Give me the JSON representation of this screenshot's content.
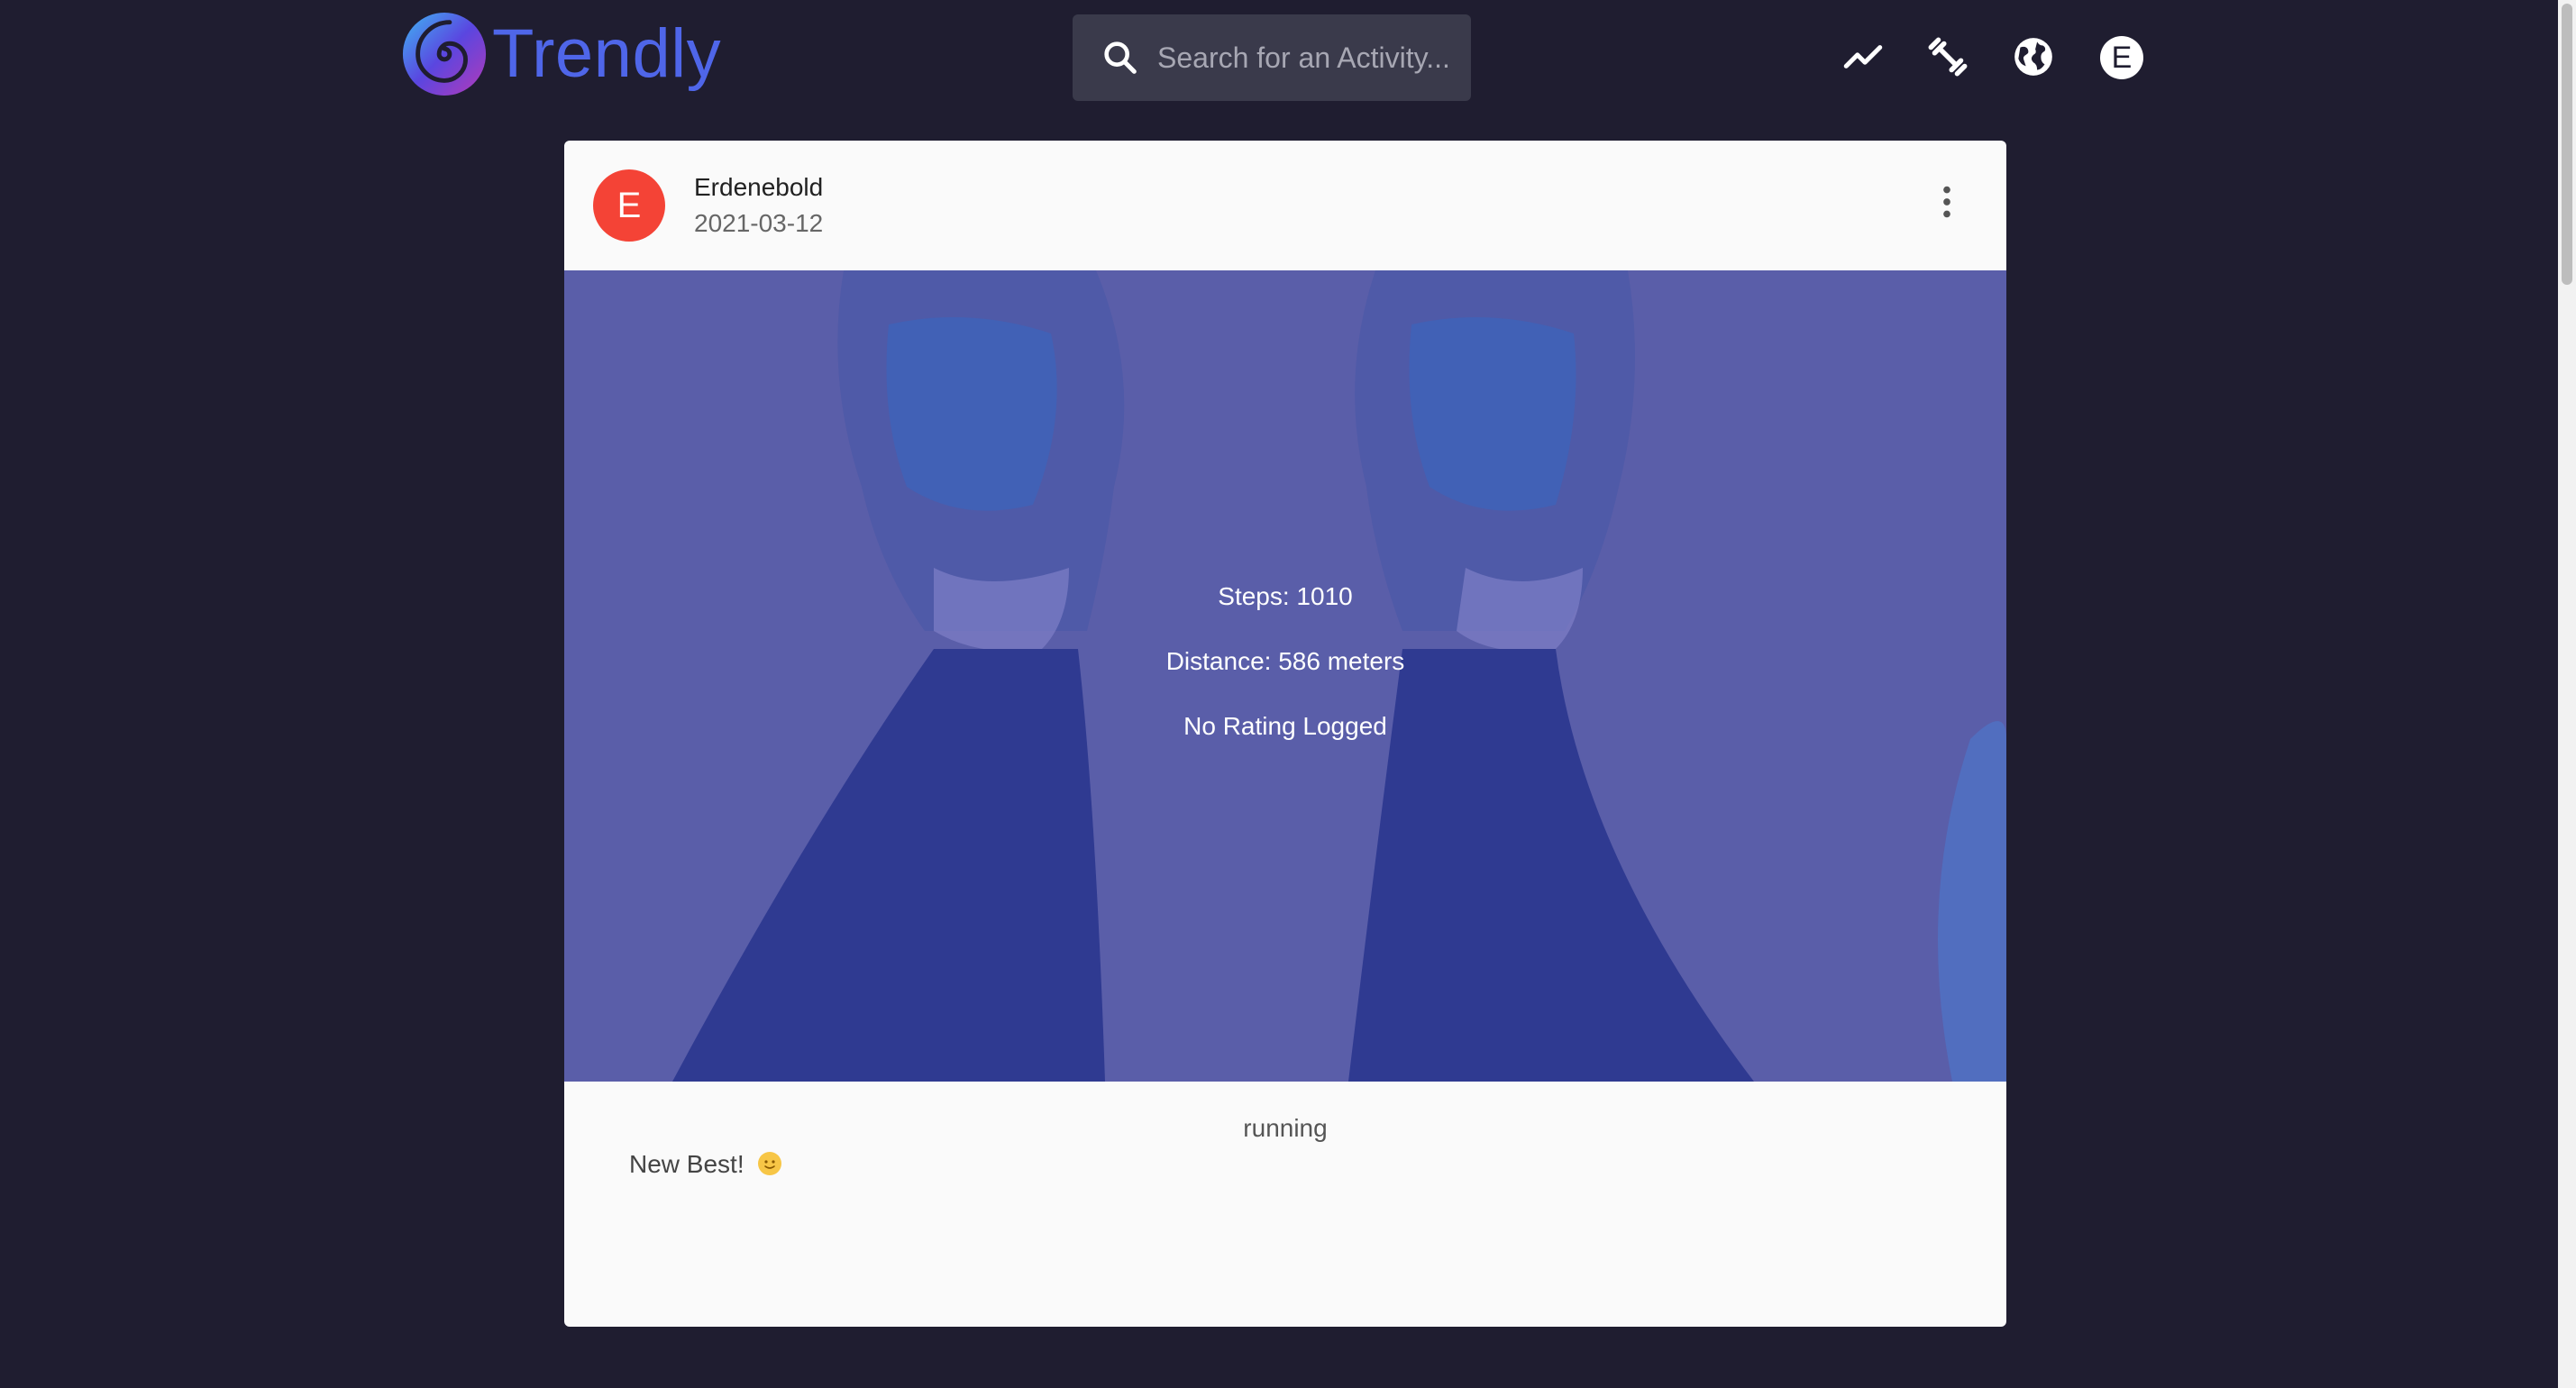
{
  "app": {
    "name": "Trendly"
  },
  "search": {
    "placeholder": "Search for an Activity..."
  },
  "nav": {
    "icons": [
      "trending-up-icon",
      "fitness-icon",
      "globe-icon"
    ],
    "user_initial": "E"
  },
  "post": {
    "author_initial": "E",
    "author": "Erdenebold",
    "date": "2021-03-12",
    "stats": {
      "steps": "Steps: 1010",
      "distance": "Distance: 586 meters",
      "rating": "No Rating Logged"
    },
    "activity": "running",
    "caption": "New Best!",
    "emoji": "smiling-face-emoji"
  },
  "colors": {
    "background": "#1f1d30",
    "brand": "#4f66e9",
    "avatar": "#f44336",
    "card": "#fafafa",
    "image_tint": "#5b5fab"
  }
}
